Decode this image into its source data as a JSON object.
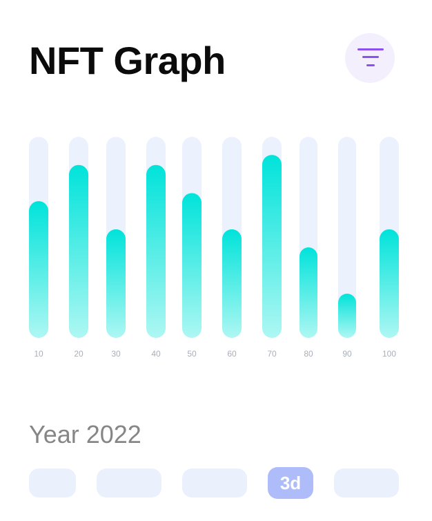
{
  "header": {
    "title": "NFT Graph",
    "filter_icon": "filter-funnel-icon"
  },
  "chart_data": {
    "type": "bar",
    "categories": [
      "10",
      "20",
      "30",
      "40",
      "50",
      "60",
      "70",
      "80",
      "90",
      "100"
    ],
    "values": [
      68,
      86,
      54,
      86,
      72,
      54,
      91,
      45,
      22,
      54
    ],
    "ylim": [
      0,
      100
    ],
    "grid": false,
    "colors": {
      "track": "#ebf1fd",
      "bar_top": "#00e3da",
      "bar_bottom": "#aef7f3",
      "tick_label": "#a7afbb"
    }
  },
  "footer": {
    "year_label": "Year 2022",
    "ranges": [
      {
        "label": "",
        "active": false
      },
      {
        "label": "",
        "active": false
      },
      {
        "label": "",
        "active": false
      },
      {
        "label": "3d",
        "active": true
      },
      {
        "label": "",
        "active": false
      }
    ]
  },
  "colors": {
    "accent": "#8c4ff0",
    "active_range": "#afbcfa",
    "inactive_range": "#ebf0fd"
  }
}
